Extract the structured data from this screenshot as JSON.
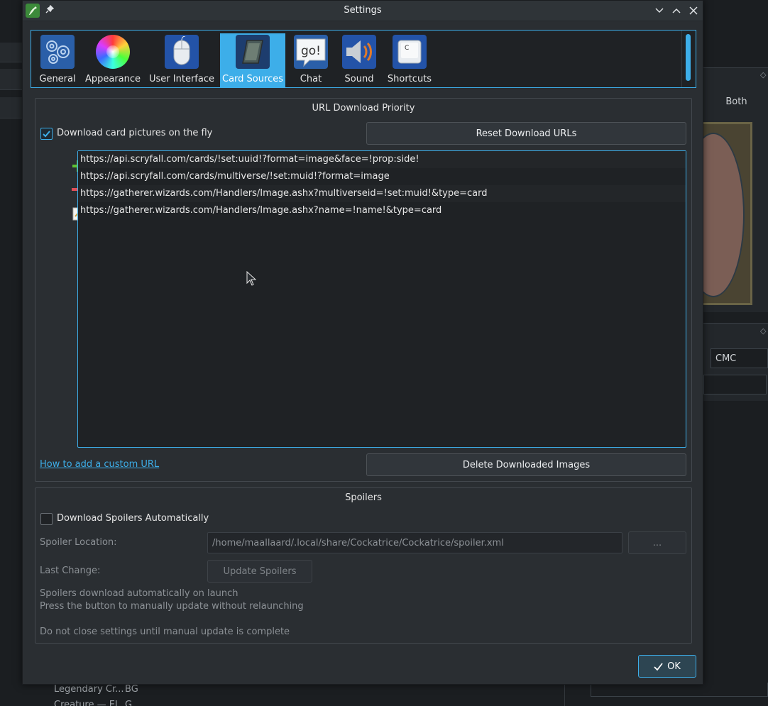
{
  "background": {
    "filter_tab_both": "Both",
    "sort_field": "CMC",
    "bottom_rows": [
      {
        "col1": "Legendary Cr...",
        "col2": "BG"
      },
      {
        "col1": "Creature — El...",
        "col2": "G"
      }
    ]
  },
  "window": {
    "title": "Settings"
  },
  "pages": [
    {
      "label": "General",
      "icon": "gears-icon"
    },
    {
      "label": "Appearance",
      "icon": "color-wheel-icon"
    },
    {
      "label": "User Interface",
      "icon": "mouse-icon"
    },
    {
      "label": "Card Sources",
      "icon": "card-icon",
      "active": true
    },
    {
      "label": "Chat",
      "icon": "chat-bubble-icon"
    },
    {
      "label": "Sound",
      "icon": "speaker-icon"
    },
    {
      "label": "Shortcuts",
      "icon": "keyboard-key-icon"
    }
  ],
  "chat_icon_text": "go!",
  "shortcuts_icon_text": "C",
  "url_group": {
    "title": "URL Download Priority",
    "download_on_fly_label": "Download card pictures on the fly",
    "download_on_fly_checked": true,
    "reset_button": "Reset Download URLs",
    "urls": [
      "https://api.scryfall.com/cards/!set:uuid!?format=image&face=!prop:side!",
      "https://api.scryfall.com/cards/multiverse/!set:muid!?format=image",
      "https://gatherer.wizards.com/Handlers/Image.ashx?multiverseid=!set:muid!&type=card",
      "https://gatherer.wizards.com/Handlers/Image.ashx?name=!name!&type=card"
    ],
    "help_link": "How to add a custom URL",
    "delete_button": "Delete Downloaded Images"
  },
  "spoilers_group": {
    "title": "Spoilers",
    "auto_download_label": "Download Spoilers Automatically",
    "auto_download_checked": false,
    "location_label": "Spoiler Location:",
    "location_value": "/home/maallaard/.local/share/Cockatrice/Cockatrice/spoiler.xml",
    "browse_button": "...",
    "last_change_label": "Last Change:",
    "update_button": "Update Spoilers",
    "info_line1": "Spoilers download automatically on launch",
    "info_line2": "Press the button to manually update without relaunching",
    "info_line3": "Do not close settings until manual update is complete"
  },
  "ok_button": "OK",
  "colors": {
    "accent": "#3daee9",
    "window_bg": "#2a2e32",
    "add_green": "#5dc235",
    "remove_red": "#e0505a"
  }
}
